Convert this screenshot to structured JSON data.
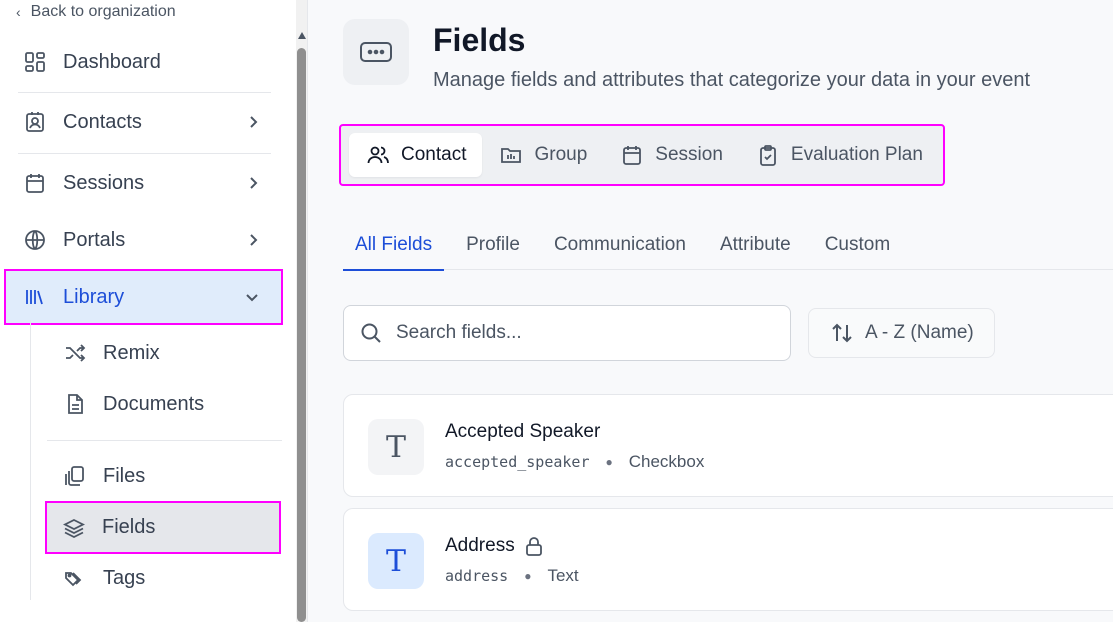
{
  "sidebar": {
    "back_label": "Back to organization",
    "items": [
      {
        "label": "Dashboard",
        "icon": "dashboard-icon"
      },
      {
        "label": "Contacts",
        "icon": "contacts-icon"
      },
      {
        "label": "Sessions",
        "icon": "calendar-icon"
      },
      {
        "label": "Portals",
        "icon": "globe-icon"
      },
      {
        "label": "Library",
        "icon": "library-icon"
      }
    ],
    "sub_items": [
      {
        "label": "Remix",
        "icon": "shuffle-icon"
      },
      {
        "label": "Documents",
        "icon": "document-icon"
      },
      {
        "label": "Files",
        "icon": "files-icon"
      },
      {
        "label": "Fields",
        "icon": "layers-icon"
      },
      {
        "label": "Tags",
        "icon": "tags-icon"
      }
    ]
  },
  "header": {
    "title": "Fields",
    "subtitle": "Manage fields and attributes that categorize your data in your event"
  },
  "category_tabs": [
    {
      "label": "Contact",
      "icon": "users-icon",
      "active": true
    },
    {
      "label": "Group",
      "icon": "group-icon"
    },
    {
      "label": "Session",
      "icon": "calendar-icon"
    },
    {
      "label": "Evaluation Plan",
      "icon": "clipboard-check-icon"
    }
  ],
  "sub_tabs": [
    {
      "label": "All Fields",
      "active": true
    },
    {
      "label": "Profile"
    },
    {
      "label": "Communication"
    },
    {
      "label": "Attribute"
    },
    {
      "label": "Custom"
    }
  ],
  "search": {
    "placeholder": "Search fields..."
  },
  "sort": {
    "label": "A - Z (Name)"
  },
  "fields": [
    {
      "avatar": "T",
      "name": "Accepted Speaker",
      "key": "accepted_speaker",
      "type": "Checkbox",
      "locked": false
    },
    {
      "avatar": "T",
      "name": "Address",
      "key": "address",
      "type": "Text",
      "locked": true
    }
  ],
  "colors": {
    "accent": "#1d4ed8",
    "highlight": "#ff00ff",
    "active_bg": "#e0ecfb"
  }
}
